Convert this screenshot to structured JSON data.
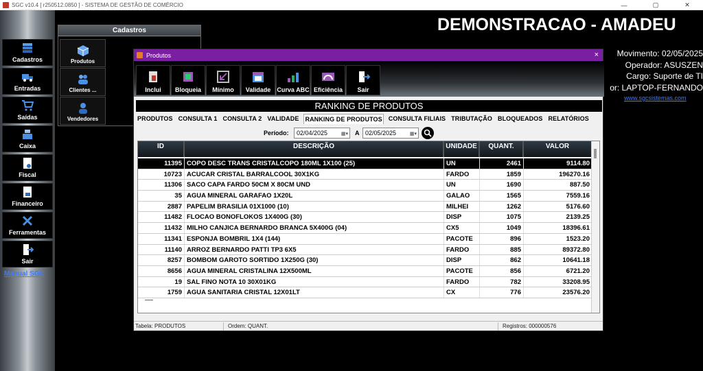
{
  "os": {
    "title": "SGC v10.4 [ r250512.0850 ] - SISTEMA DE GESTÃO DE COMÉRCIO",
    "minimize": "—",
    "maximize": "▢",
    "close": "✕"
  },
  "sidebar": {
    "items": [
      {
        "label": "Cadastros",
        "icon": "cadastros-icon"
      },
      {
        "label": "Entradas",
        "icon": "truck-icon"
      },
      {
        "label": "Saídas",
        "icon": "cart-icon"
      },
      {
        "label": "Caixa",
        "icon": "cash-register-icon"
      },
      {
        "label": "Fiscal",
        "icon": "fiscal-document-icon"
      },
      {
        "label": "Financeiro",
        "icon": "finance-document-icon"
      },
      {
        "label": "Ferramentas",
        "icon": "tools-icon"
      },
      {
        "label": "Sair",
        "icon": "exit-door-icon"
      }
    ],
    "manual_link": "Manual SGC"
  },
  "cadastros_panel": {
    "title": "Cadastros",
    "items": [
      {
        "label": "Produtos",
        "icon": "box-icon"
      },
      {
        "label": "Clientes ...",
        "icon": "people-icon"
      },
      {
        "label": "Vendedores",
        "icon": "salesperson-icon"
      }
    ]
  },
  "header": {
    "company": "DEMONSTRACAO - AMADEU",
    "movimento": "Movimento: 02/05/2025",
    "operador": "Operador: ASUSZEN",
    "cargo": "Cargo: Suporte de TI",
    "terminal": "or: LAPTOP-FERNANDO",
    "website": "www.sgcsistemas.com"
  },
  "window": {
    "title": "Produtos",
    "close": "×",
    "toolbar": [
      {
        "label": "Inclui",
        "icon": "include-icon"
      },
      {
        "label": "Bloqueia",
        "icon": "block-icon"
      },
      {
        "label": "Mínimo",
        "icon": "minimum-icon"
      },
      {
        "label": "Validade",
        "icon": "calendar-icon"
      },
      {
        "label": "Curva ABC",
        "icon": "abc-curve-icon"
      },
      {
        "label": "Eficiência",
        "icon": "gauge-icon"
      },
      {
        "label": "Sair",
        "icon": "exit-door-icon"
      }
    ],
    "ranking_title": "RANKING DE PRODUTOS",
    "tabs": [
      "PRODUTOS",
      "CONSULTA 1",
      "CONSULTA 2",
      "VALIDADE",
      "RANKING DE PRODUTOS",
      "CONSULTA FILIAIS",
      "TRIBUTAÇÃO",
      "BLOQUEADOS",
      "RELATÓRIOS"
    ],
    "active_tab": 4,
    "period": {
      "label": "Período:",
      "from": "02/04/2025",
      "separator": "A",
      "to": "02/05/2025"
    },
    "grid": {
      "columns": [
        "ID",
        "DESCRIÇÃO",
        "UNIDADE",
        "QUANT.",
        "VALOR"
      ],
      "rows": [
        [
          "11395",
          "COPO DESC TRANS CRISTALCOPO 180ML 1X100 (25)",
          "UN",
          "2461",
          "9114.80"
        ],
        [
          "10723",
          "ACUCAR CRISTAL BARRALCOOL 30X1KG",
          "FARDO",
          "1859",
          "196270.16"
        ],
        [
          "11306",
          "SACO CAPA FARDO 50CM X 80CM UND",
          "UN",
          "1690",
          "887.50"
        ],
        [
          "35",
          "AGUA MINERAL GARAFAO 1X20L",
          "GALAO",
          "1565",
          "7559.16"
        ],
        [
          "2887",
          "PAPELIM BRASILIA 01X1000 (10)",
          "MILHEI",
          "1262",
          "5176.60"
        ],
        [
          "11482",
          "FLOCAO BONOFLOKOS 1X400G (30)",
          "DISP",
          "1075",
          "2139.25"
        ],
        [
          "11432",
          "MILHO CANJICA BERNARDO BRANCA 5X400G (04)",
          "CX5",
          "1049",
          "18396.61"
        ],
        [
          "11341",
          "ESPONJA BOMBRIL 1X4 (144)",
          "PACOTE",
          "896",
          "1523.20"
        ],
        [
          "11140",
          "ARROZ BERNARDO PATTI TP3 6X5",
          "FARDO",
          "885",
          "89372.80"
        ],
        [
          "8257",
          "BOMBOM GAROTO SORTIDO 1X250G (30)",
          "DISP",
          "862",
          "10641.18"
        ],
        [
          "8656",
          "AGUA MINERAL CRISTALINA 12X500ML",
          "PACOTE",
          "856",
          "6721.20"
        ],
        [
          "19",
          "SAL FINO NOTA 10 30X01KG",
          "FARDO",
          "782",
          "33208.95"
        ],
        [
          "1759",
          "AGUA SANITARIA CRISTAL 12X01LT",
          "CX",
          "776",
          "23576.20"
        ]
      ]
    },
    "status": {
      "tabela": "Tabela: PRODUTOS",
      "ordem": "Ordem: QUANT.",
      "registros": "Registros: 000000576"
    }
  }
}
